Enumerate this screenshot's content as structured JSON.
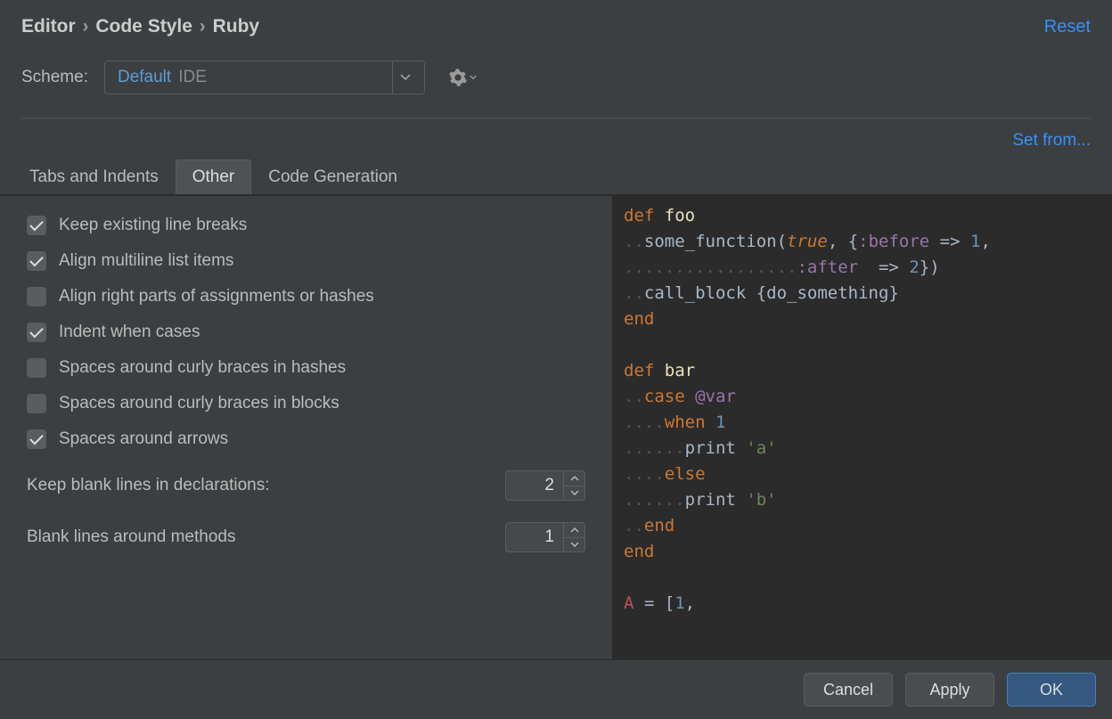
{
  "breadcrumb": {
    "part1": "Editor",
    "part2": "Code Style",
    "part3": "Ruby",
    "sep": "›"
  },
  "reset": "Reset",
  "scheme": {
    "label": "Scheme:",
    "name": "Default",
    "scope": "IDE"
  },
  "setfrom": "Set from...",
  "tabs": [
    {
      "label": "Tabs and Indents"
    },
    {
      "label": "Other"
    },
    {
      "label": "Code Generation"
    }
  ],
  "checks": [
    {
      "label": "Keep existing line breaks",
      "checked": true
    },
    {
      "label": "Align multiline list items",
      "checked": true
    },
    {
      "label": "Align right parts of assignments or hashes",
      "checked": false
    },
    {
      "label": "Indent when cases",
      "checked": true
    },
    {
      "label": "Spaces around curly braces in hashes",
      "checked": false
    },
    {
      "label": "Spaces around curly braces in blocks",
      "checked": false
    },
    {
      "label": "Spaces around arrows",
      "checked": true
    }
  ],
  "numbers": [
    {
      "label": "Keep blank lines in declarations:",
      "value": "2"
    },
    {
      "label": "Blank lines around methods",
      "value": "1"
    }
  ],
  "code": {
    "l1a": "def",
    "l1b": "foo",
    "l2a": "some_function(",
    "l2b": "true",
    "l2c": ", {",
    "l2d": ":before",
    "l2e": " => ",
    "l2f": "1",
    "l2g": ",",
    "l3a": ":after",
    "l3b": "  => ",
    "l3c": "2",
    "l3d": "})",
    "l4a": "call_block {do_something}",
    "l5a": "end",
    "l7a": "def",
    "l7b": "bar",
    "l8a": "case",
    "l8b": "@var",
    "l9a": "when",
    "l9b": "1",
    "l10a": "print ",
    "l10b": "'a'",
    "l11a": "else",
    "l12a": "print ",
    "l12b": "'b'",
    "l13a": "end",
    "l14a": "end",
    "l16a": "A",
    "l16b": " = [",
    "l16c": "1",
    "l16d": ","
  },
  "buttons": {
    "cancel": "Cancel",
    "apply": "Apply",
    "ok": "OK"
  }
}
